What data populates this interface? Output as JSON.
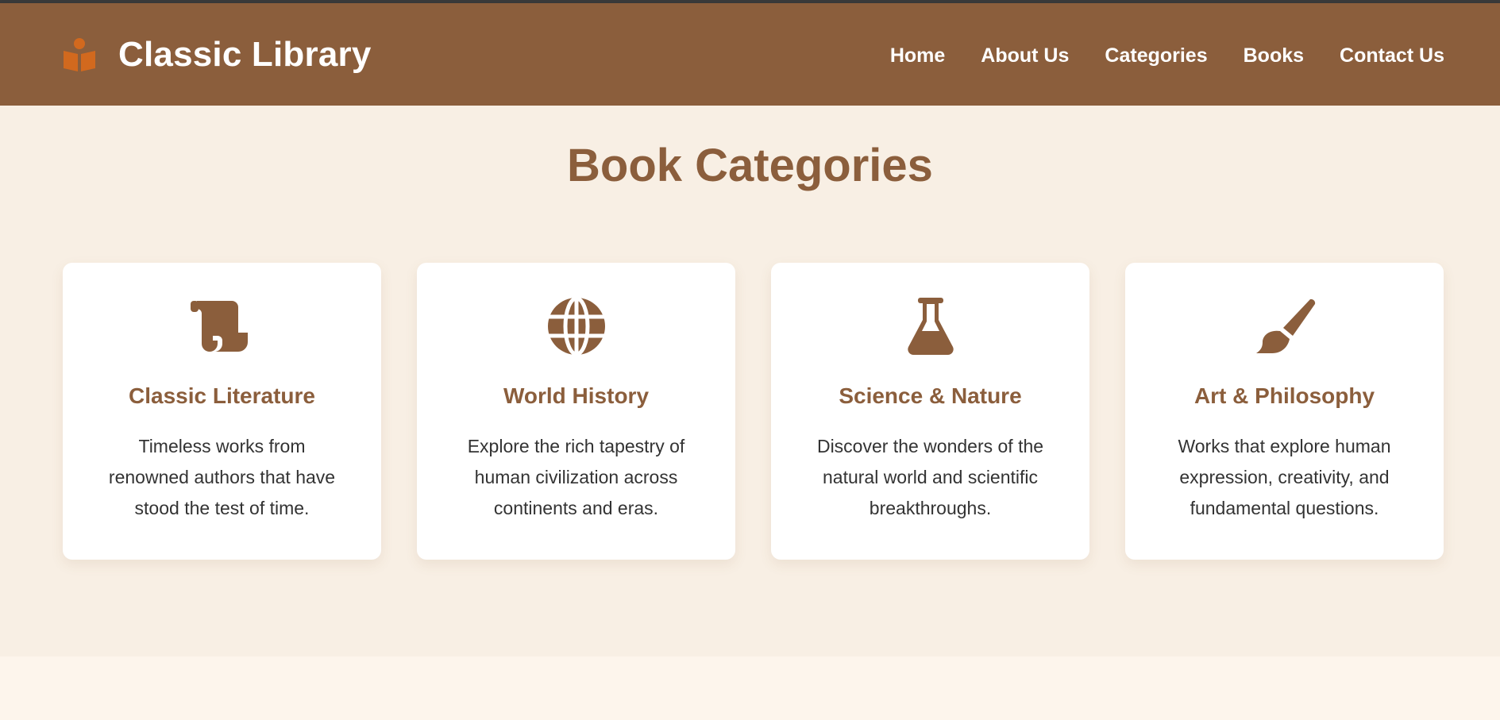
{
  "header": {
    "brand_title": "Classic Library",
    "brand_icon": "book-reader-icon",
    "nav": [
      {
        "label": "Home"
      },
      {
        "label": "About Us"
      },
      {
        "label": "Categories"
      },
      {
        "label": "Books"
      },
      {
        "label": "Contact Us"
      }
    ]
  },
  "main": {
    "section_title": "Book Categories",
    "cards": [
      {
        "icon": "scroll-icon",
        "title": "Classic Literature",
        "description": "Timeless works from renowned authors that have stood the test of time."
      },
      {
        "icon": "globe-icon",
        "title": "World History",
        "description": "Explore the rich tapestry of human civilization across continents and eras."
      },
      {
        "icon": "flask-icon",
        "title": "Science & Nature",
        "description": "Discover the wonders of the natural world and scientific breakthroughs."
      },
      {
        "icon": "paintbrush-icon",
        "title": "Art & Philosophy",
        "description": "Works that explore human expression, creativity, and fundamental questions."
      }
    ]
  },
  "colors": {
    "header_bg": "#8b5e3c",
    "accent": "#8b5e3c",
    "brand_icon": "#d2691e",
    "page_bg": "#f8efe4",
    "card_bg": "#ffffff",
    "body_text": "#333333"
  }
}
